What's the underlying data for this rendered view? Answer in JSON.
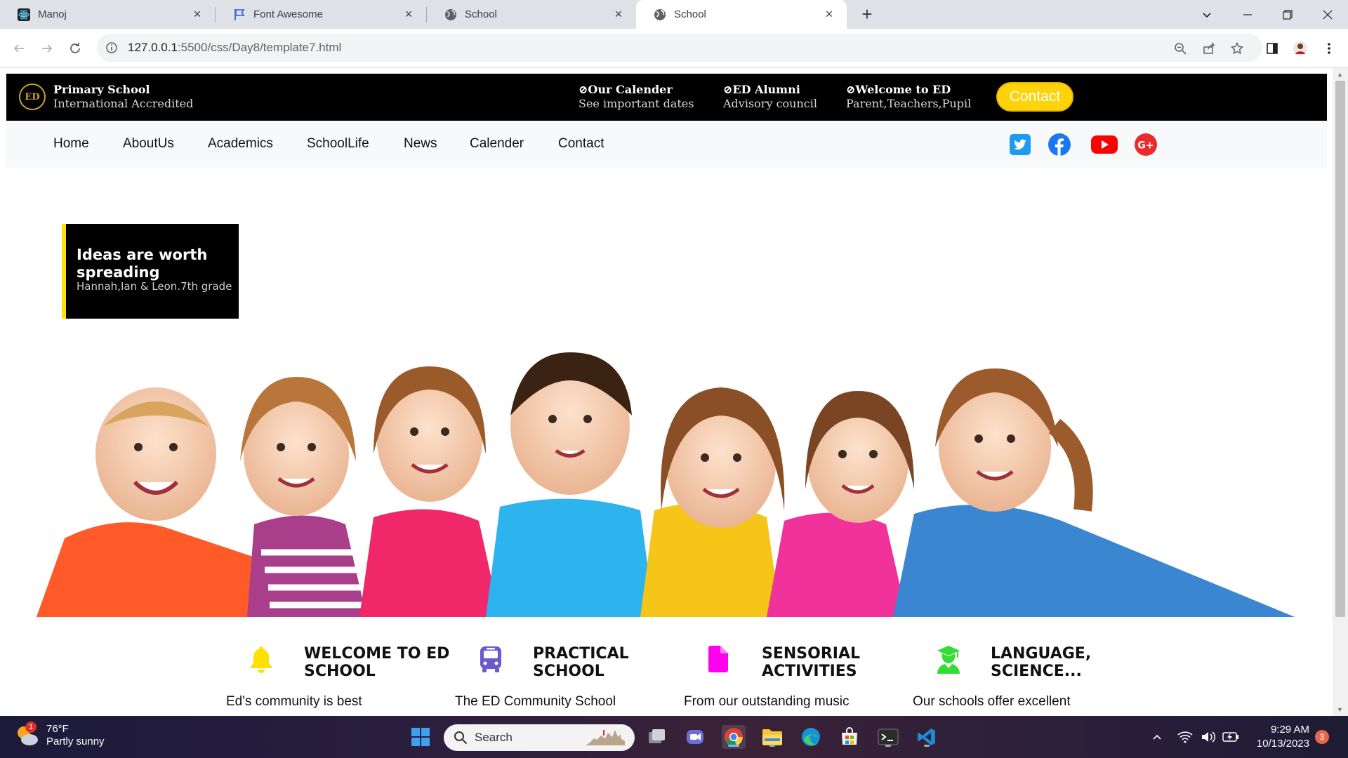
{
  "browser": {
    "tabs": [
      {
        "title": "Manoj",
        "icon": "react-icon",
        "active": false
      },
      {
        "title": "Font Awesome",
        "icon": "flag-icon",
        "active": false
      },
      {
        "title": "School",
        "icon": "globe-icon",
        "active": false
      },
      {
        "title": "School",
        "icon": "globe-icon",
        "active": true
      }
    ],
    "url_host": "127.0.0.1",
    "url_path": ":5500/css/Day8/template7.html"
  },
  "site": {
    "brand": {
      "title": "Primary School",
      "subtitle": "International Accredited",
      "logo_text": "ED"
    },
    "header_blocks": [
      {
        "title": "⊘Our Calender",
        "subtitle": "See important dates"
      },
      {
        "title": "⊘ED Alumni",
        "subtitle": "Advisory council"
      },
      {
        "title": "⊘Welcome to ED",
        "subtitle": "Parent,Teachers,Pupil"
      }
    ],
    "contact_button": "Contact",
    "nav": [
      "Home",
      "AboutUs",
      "Academics",
      "SchoolLife",
      "News",
      "Calender",
      "Contact"
    ],
    "social": [
      {
        "name": "twitter-icon",
        "color": "#1d9bf0"
      },
      {
        "name": "facebook-icon",
        "color": "#1877f2"
      },
      {
        "name": "youtube-icon",
        "color": "#ff0000"
      },
      {
        "name": "google-plus-icon",
        "color": "#ea2b2b"
      }
    ],
    "quote": {
      "title": "Ideas are worth spreading",
      "subtitle": "Hannah,Ian & Leon.7th grade"
    },
    "features": [
      {
        "title": "WELCOME TO ED SCHOOL",
        "text": "Ed's community is best",
        "icon": "bell-icon",
        "color": "#ffd600"
      },
      {
        "title": "PRACTICAL SCHOOL",
        "text": "The ED Community School",
        "icon": "bus-icon",
        "color": "#6a5acd"
      },
      {
        "title": "SENSORIAL ACTIVITIES",
        "text": "From our outstanding music",
        "icon": "file-icon",
        "color": "#ff00ff"
      },
      {
        "title": "LANGUAGE, SCIENCE...",
        "text": "Our schools offer excellent",
        "icon": "user-graduate-icon",
        "color": "#33cc33"
      }
    ]
  },
  "taskbar": {
    "weather_temp": "76°F",
    "weather_desc": "Partly sunny",
    "weather_badge": "1",
    "search_placeholder": "Search",
    "time": "9:29 AM",
    "date": "10/13/2023",
    "notifications": "3"
  }
}
